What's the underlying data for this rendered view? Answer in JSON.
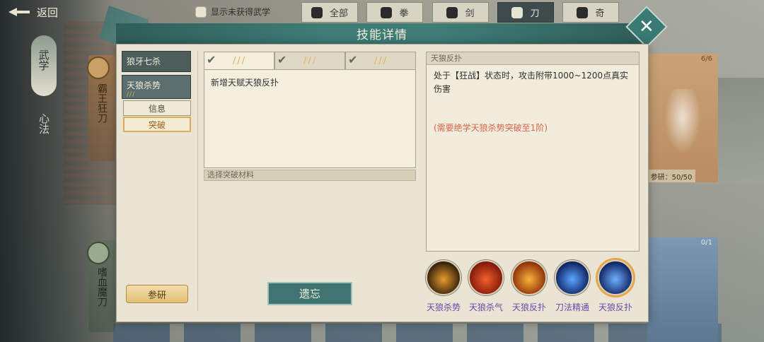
{
  "topbar": {
    "back_label": "返回",
    "show_unobtained_label": "显示未获得武学",
    "categories": [
      {
        "label": "全部",
        "active": false,
        "icon": "bag-icon"
      },
      {
        "label": "拳",
        "active": false,
        "icon": "fist-icon"
      },
      {
        "label": "剑",
        "active": false,
        "icon": "sword-icon"
      },
      {
        "label": "刀",
        "active": true,
        "icon": "blade-icon"
      },
      {
        "label": "奇",
        "active": false,
        "icon": "shuriken-icon"
      }
    ]
  },
  "sidebar": {
    "wuxue_label": "武学",
    "xinfa_label": "心法",
    "skill_left_1": "霸王狂刀",
    "skill_left_2": "嗜血魔刀"
  },
  "background_cards": {
    "right_top_count": "6/6",
    "canyan_label": "参研：50/50",
    "right_bottom_count": "0/1"
  },
  "modal": {
    "title": "技能详情",
    "skill_tabs": [
      {
        "label": "狼牙七杀",
        "stars": "",
        "selected": false
      },
      {
        "label": "天狼杀势",
        "stars": "///",
        "selected": true
      }
    ],
    "sub_tabs": [
      {
        "label": "信息",
        "active": false
      },
      {
        "label": "突破",
        "active": true
      }
    ],
    "research_label": "参研",
    "stage_tabs": [
      {
        "check": "✔",
        "stars_on": "///",
        "stars_off": ""
      },
      {
        "check": "✔",
        "stars_on": "//",
        "stars_off": "/"
      },
      {
        "check": "✔",
        "stars_on": "///",
        "stars_off": ""
      }
    ],
    "unlock_text": "新增天赋天狼反扑",
    "material_label": "选择突破材料",
    "forget_label": "遗忘",
    "detail": {
      "title": "天狼反扑",
      "description": "处于【狂战】状态时，攻击附带1000~1200点真实伤害",
      "requirement": "(需要绝学天狼杀势突破至1阶)"
    },
    "skill_icons": [
      {
        "label": "天狼杀势",
        "icon": "crescent-slash-icon",
        "colors": [
          "#2a1a0a",
          "#e89b2a"
        ],
        "selected": false
      },
      {
        "label": "天狼杀气",
        "icon": "red-claw-icon",
        "colors": [
          "#7a1408",
          "#f2602a"
        ],
        "selected": false
      },
      {
        "label": "天狼反扑",
        "icon": "fire-claw-icon",
        "colors": [
          "#8a2a06",
          "#f8b23a"
        ],
        "selected": false
      },
      {
        "label": "刀法精通",
        "icon": "blue-warrior-icon",
        "colors": [
          "#0b1b5a",
          "#5aa6ff"
        ],
        "selected": false
      },
      {
        "label": "天狼反扑",
        "icon": "blue-warrior-icon",
        "colors": [
          "#0b1b5a",
          "#6fb0ff"
        ],
        "selected": true
      }
    ]
  },
  "colors": {
    "header_teal": "#3f7d77",
    "requirement_red": "#d9644a",
    "skill_label_purple": "#6b48a8",
    "star_gold": "#e3b35c"
  }
}
